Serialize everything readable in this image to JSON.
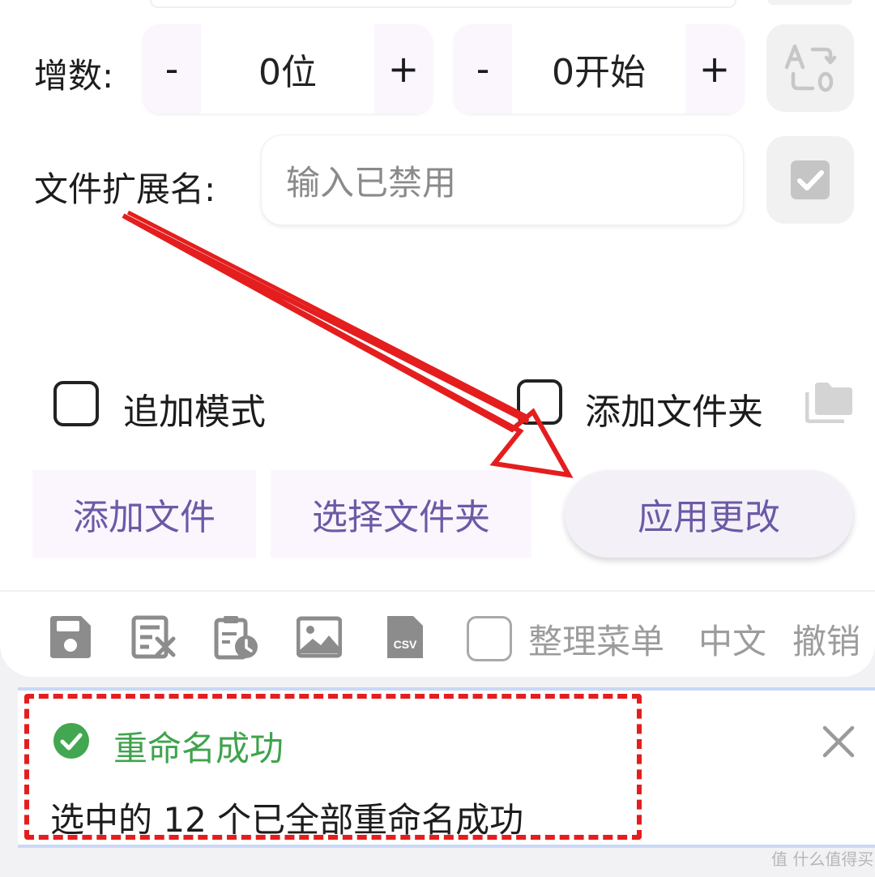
{
  "increment": {
    "label": "增数:",
    "digits": {
      "minus": "-",
      "value": "0位",
      "plus": "+"
    },
    "start": {
      "minus": "-",
      "value": "0开始",
      "plus": "+"
    }
  },
  "extension": {
    "label": "文件扩展名:",
    "placeholder": "输入已禁用"
  },
  "options": {
    "append_mode": "追加模式",
    "add_folder": "添加文件夹"
  },
  "actions": {
    "add_files": "添加文件",
    "choose_folder": "选择文件夹",
    "apply": "应用更改"
  },
  "toolbar": {
    "organize_menu": "整理菜单",
    "chinese": "中文",
    "undo": "撤销",
    "csv": "CSV"
  },
  "toast": {
    "title": "重命名成功",
    "message": "选中的 12 个已全部重命名成功"
  },
  "watermark": "值 什么值得买",
  "colors": {
    "accent_text": "#6b5aa6",
    "success": "#3fa34d",
    "annotation": "#e41e1e"
  }
}
